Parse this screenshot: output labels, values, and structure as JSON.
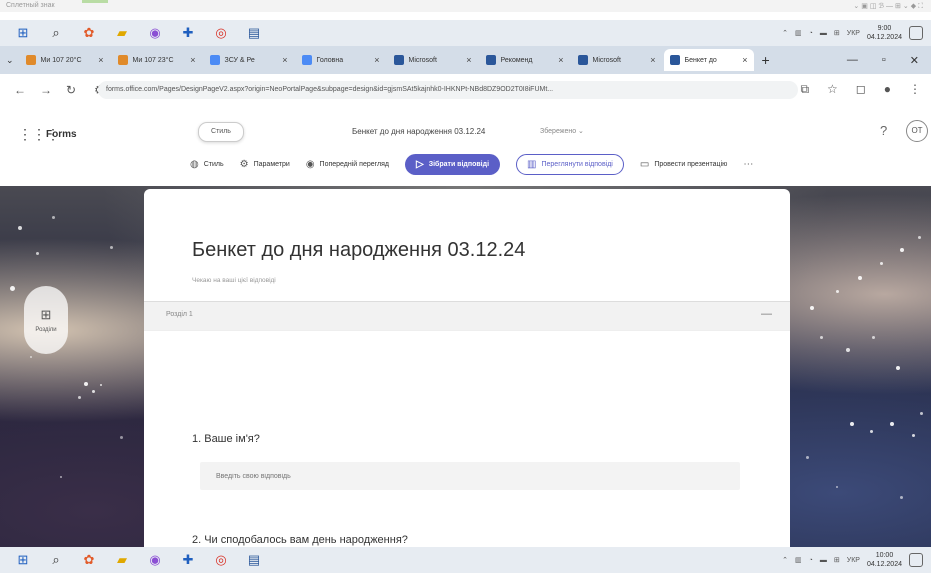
{
  "window": {
    "caption": "Сплетный знак",
    "controls": [
      "⌄",
      "▣",
      "◫",
      "ℬ",
      "—",
      "⊞",
      "⌄",
      "◆",
      "⛶"
    ]
  },
  "taskbar": {
    "tray": [
      "⌃",
      "▥",
      "◔",
      "▬",
      "⊞",
      "УКР"
    ],
    "time_top": "9:00",
    "date_top": "04.12.2024",
    "time_bottom": "10:00",
    "date_bottom": "04.12.2024"
  },
  "browser": {
    "tabs": [
      {
        "label": "Ми 107 20°С",
        "icon": "orange"
      },
      {
        "label": "Ми 107 23°С",
        "icon": "orange"
      },
      {
        "label": "ЗСУ & Ре",
        "icon": "blue"
      },
      {
        "label": "Головна",
        "icon": "blue"
      },
      {
        "label": "Microsoft",
        "icon": "word"
      },
      {
        "label": "Рекоменд",
        "icon": "word"
      },
      {
        "label": "Microsoft",
        "icon": "word"
      },
      {
        "label": "Бенкет до",
        "icon": "word"
      }
    ],
    "url": "forms.office.com/Pages/DesignPageV2.aspx?origin=NeoPortalPage&subpage=design&id=gjsmSAt5kajnhk0-IHKNPt-NBd8DZ9OD2T0I8iFUMt..."
  },
  "forms": {
    "app_name": "Forms",
    "style_tip": "Стиль",
    "doc_title": "Бенкет до дня народження 03.12.24",
    "save_state": "Збережено",
    "avatar": "ОТ",
    "toolbar": {
      "style": "Стиль",
      "settings": "Параметри",
      "preview": "Попередній перегляд",
      "collect": "Зібрати відповіді",
      "view_responses": "Переглянути відповіді",
      "present": "Провести презентацію"
    },
    "section_nav_label": "Розділи"
  },
  "form": {
    "title": "Бенкет до дня народження 03.12.24",
    "description": "Чекаю на ваші цієї відповіді",
    "section_label": "Розділ 1",
    "q1": "1. Ваше ім'я?",
    "q1_placeholder": "Введіть свою відповідь",
    "q2": "2. Чи сподобалось вам день народження?"
  },
  "icons": {
    "waffle": "grid-icon",
    "style": "palette-icon",
    "settings": "gear-icon",
    "preview": "eye-icon",
    "collect": "send-icon",
    "view": "chart-icon",
    "present": "present-icon",
    "help": "help-icon",
    "collapse": "minus-icon"
  },
  "colors": {
    "accent": "#5b5fc7",
    "taskbar": "#e7ecf2",
    "tabbar": "#d4dde8"
  }
}
